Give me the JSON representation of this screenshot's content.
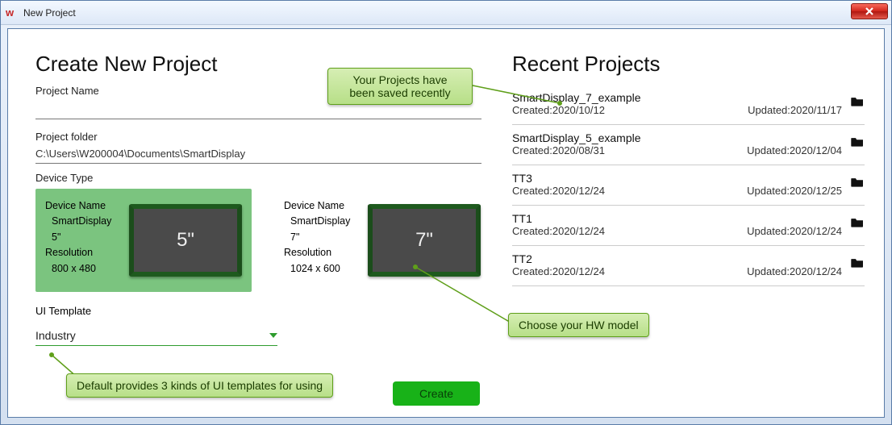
{
  "window": {
    "title": "New Project"
  },
  "page": {
    "heading": "Create New Project",
    "project_name_label": "Project Name",
    "project_name_value": "",
    "project_folder_label": "Project folder",
    "project_folder_value": "C:\\Users\\W200004\\Documents\\SmartDisplay",
    "device_type_label": "Device Type",
    "devices": [
      {
        "name_label": "Device Name",
        "name": "SmartDisplay 5\"",
        "res_label": "Resolution",
        "res": "800 x 480",
        "screen": "5\"",
        "selected": true
      },
      {
        "name_label": "Device Name",
        "name": "SmartDisplay 7\"",
        "res_label": "Resolution",
        "res": "1024 x 600",
        "screen": "7\"",
        "selected": false
      }
    ],
    "ui_template_label": "UI Template",
    "ui_template_value": "Industry",
    "create_label": "Create"
  },
  "recent": {
    "heading": "Recent Projects",
    "items": [
      {
        "name": "SmartDisplay_7_example",
        "created": "Created:2020/10/12",
        "updated": "Updated:2020/11/17"
      },
      {
        "name": "SmartDisplay_5_example",
        "created": "Created:2020/08/31",
        "updated": "Updated:2020/12/04"
      },
      {
        "name": "TT3",
        "created": "Created:2020/12/24",
        "updated": "Updated:2020/12/25"
      },
      {
        "name": "TT1",
        "created": "Created:2020/12/24",
        "updated": "Updated:2020/12/24"
      },
      {
        "name": "TT2",
        "created": "Created:2020/12/24",
        "updated": "Updated:2020/12/24"
      }
    ]
  },
  "annotations": {
    "saved": "Your Projects have\nbeen saved recently",
    "hw": "Choose your HW model",
    "templates": "Default provides 3 kinds of UI templates for using"
  }
}
